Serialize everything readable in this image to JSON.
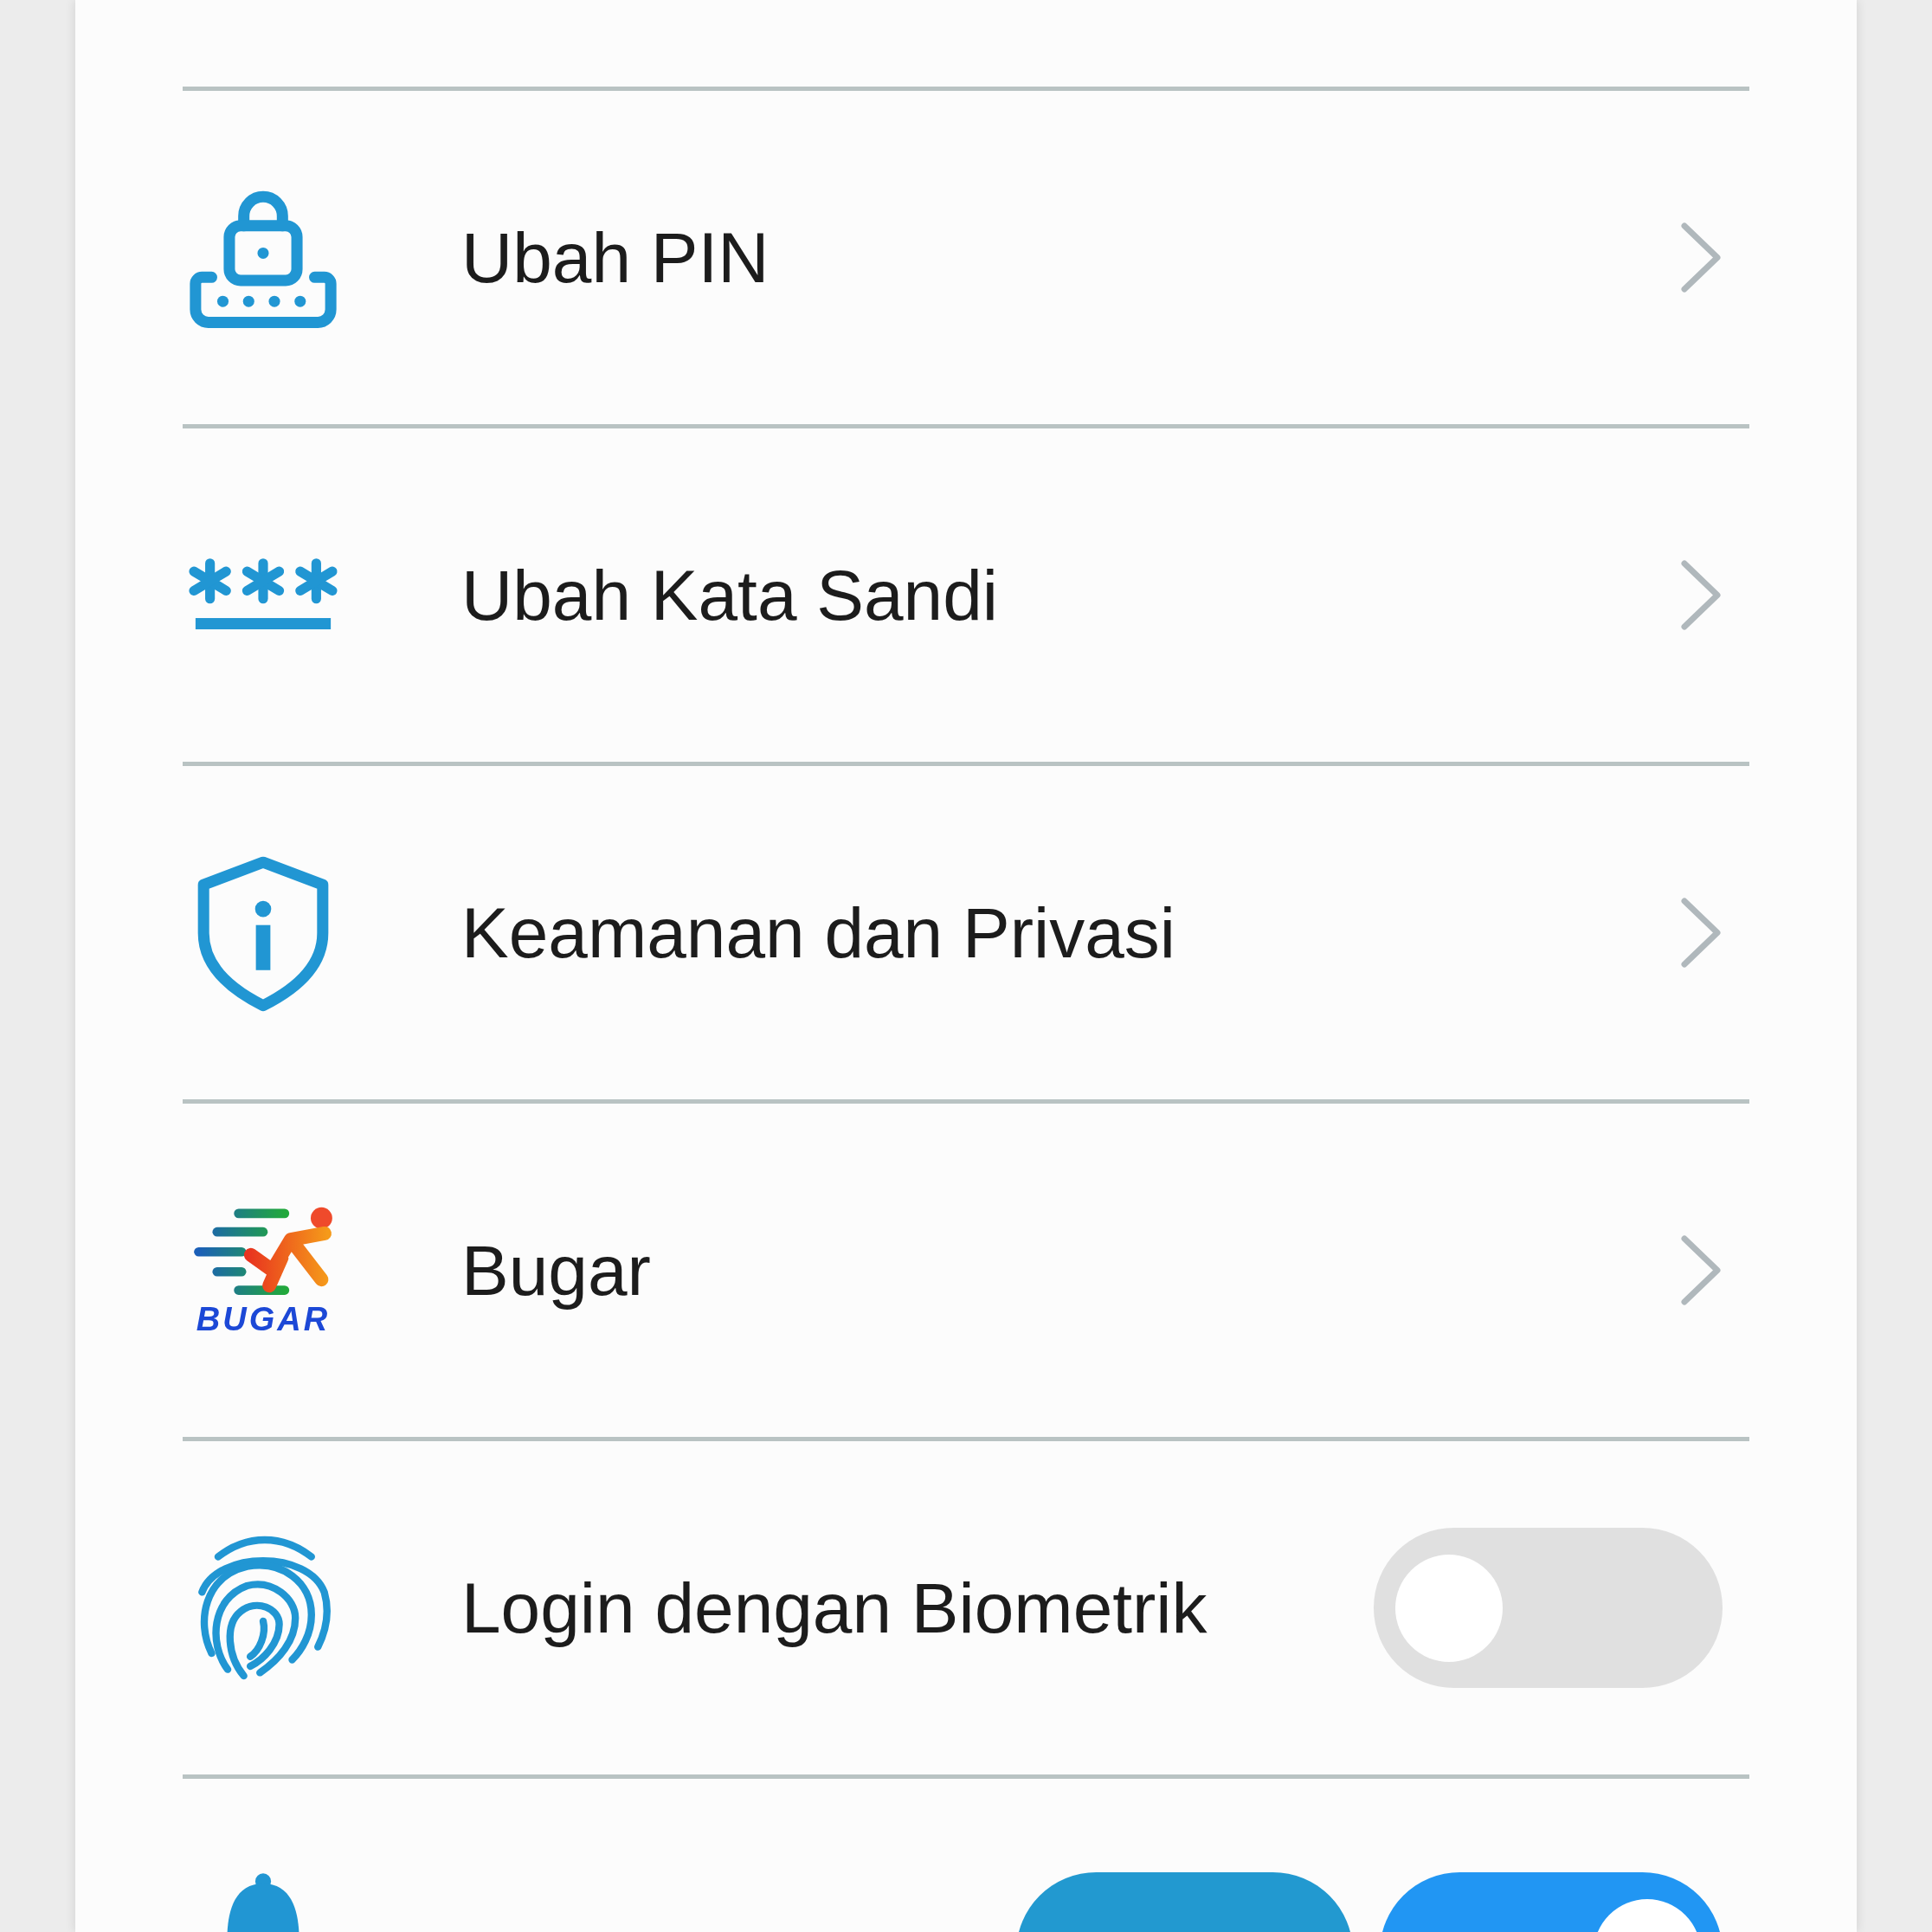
{
  "settings": [
    {
      "kind": "link",
      "label": "Ubah PIN"
    },
    {
      "kind": "link",
      "label": "Ubah Kata Sandi"
    },
    {
      "kind": "link",
      "label": "Keamanan dan Privasi"
    },
    {
      "kind": "link",
      "label": "Bugar",
      "logo_text": "BUGAR"
    },
    {
      "kind": "toggle",
      "label": "Login dengan Biometrik",
      "on": false
    },
    {
      "kind": "cut",
      "on": true
    }
  ]
}
